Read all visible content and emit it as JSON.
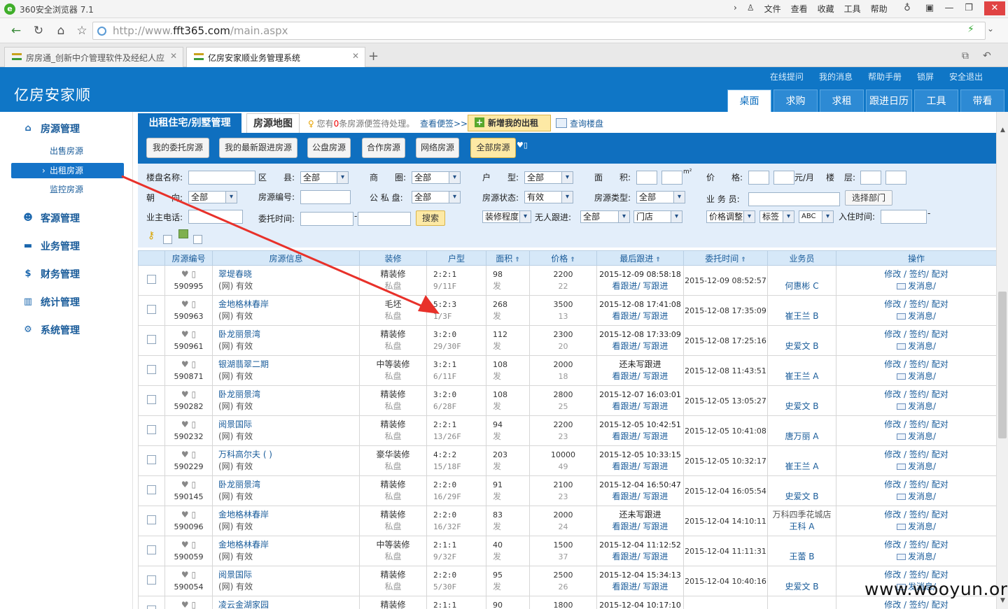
{
  "browser": {
    "title": "360安全浏览器 7.1",
    "menu": [
      "文件",
      "查看",
      "收藏",
      "工具",
      "帮助"
    ],
    "url_prefix": "http://www.",
    "url_host": "fft365.com",
    "url_path": "/main.aspx",
    "tabs": [
      {
        "label": "房房通_创新中介管理软件及经纪人应"
      },
      {
        "label": "亿房安家顺业务管理系统"
      }
    ]
  },
  "app": {
    "brand": "亿房安家顺",
    "top_links": [
      "在线提问",
      "我的消息",
      "帮助手册",
      "锁屏",
      "安全退出"
    ],
    "nav_tabs": [
      "桌面",
      "求购",
      "求租",
      "跟进日历",
      "工具",
      "带看"
    ]
  },
  "sidebar": {
    "groups": [
      {
        "label": "房源管理",
        "icon": "house-icon"
      },
      {
        "label": "客源管理",
        "icon": "users-icon"
      },
      {
        "label": "业务管理",
        "icon": "car-icon"
      },
      {
        "label": "财务管理",
        "icon": "money-icon"
      },
      {
        "label": "统计管理",
        "icon": "bar-chart-icon"
      },
      {
        "label": "系统管理",
        "icon": "gear-icon"
      }
    ],
    "subitems": [
      "出售房源",
      "出租房源",
      "监控房源"
    ]
  },
  "main": {
    "tab_active": "出租住宅/别墅管理",
    "tab_map": "房源地图",
    "notice_pre": "您有",
    "notice_count": "0",
    "notice_post": "条房源便签待处理。",
    "notice_link": "查看便签>>",
    "add_button": "新增我的出租",
    "query_link": "查询楼盘",
    "scope_buttons": [
      "我的委托房源",
      "我的最新跟进房源",
      "公盘房源",
      "合作房源",
      "网络房源",
      "全部房源"
    ]
  },
  "filters": {
    "estate_label": "楼盘名称:",
    "district_label": "区　　县:",
    "district_value": "全部",
    "circle_label": "商　　圈:",
    "circle_value": "全部",
    "layout_label": "户　　型:",
    "layout_value": "全部",
    "area_label": "面　　积:",
    "area_unit": "m²",
    "price_label": "价　　格:",
    "price_unit": "元/月",
    "building_label": "楼",
    "floor_label": "层:",
    "orient_label": "朝　　向:",
    "orient_value": "全部",
    "code_label": "房源编号:",
    "public_label": "公 私 盘:",
    "public_value": "全部",
    "status_label": "房源状态:",
    "status_value": "有效",
    "type_label": "房源类型:",
    "type_value": "全部",
    "agent_label": "业 务 员:",
    "dept_button": "选择部门",
    "owner_phone_label": "业主电话:",
    "entrust_label": "委托时间:",
    "search_button": "搜索",
    "decor_value": "装修程度",
    "nofollow_label": "无人跟进:",
    "nofollow_value": "全部",
    "store_value": "门店",
    "priceadj_value": "价格调整",
    "tag_value": "标签",
    "abc_value": "ABC",
    "checkin_label": "入住时间:"
  },
  "table": {
    "headers": [
      "房源编号",
      "房源信息",
      "装修",
      "户型",
      "面积",
      "价格",
      "最后跟进",
      "委托时间",
      "业务员",
      "操作"
    ],
    "ops_line1": [
      "修改",
      "签约",
      "配对"
    ],
    "ops_line2": "发消息",
    "rows": [
      {
        "id": "590995",
        "name": "翠堤春晓",
        "src": "(网) 有效",
        "decor": "精装修",
        "pub": "私盘",
        "layout": "2:2:1",
        "floor": "9/11F",
        "area": "98",
        "area2": "发",
        "price": "2200",
        "price2": "22",
        "last": "2015-12-09 08:58:18",
        "entrust": "2015-12-09 08:52:57",
        "agent_store": "",
        "agent": "何惠彬 C"
      },
      {
        "id": "590963",
        "name": "金地格林春岸",
        "src": "(网) 有效",
        "decor": "毛坯",
        "pub": "私盘",
        "layout": "5:2:3",
        "floor": "1/3F",
        "area": "268",
        "area2": "发",
        "price": "3500",
        "price2": "13",
        "last": "2015-12-08 17:41:08",
        "entrust": "2015-12-08 17:35:09",
        "agent_store": "",
        "agent": "崔王兰 B"
      },
      {
        "id": "590961",
        "name": "卧龙丽景湾",
        "src": "(网) 有效",
        "decor": "精装修",
        "pub": "私盘",
        "layout": "3:2:0",
        "floor": "29/30F",
        "area": "112",
        "area2": "发",
        "price": "2300",
        "price2": "20",
        "last": "2015-12-08 17:33:09",
        "entrust": "2015-12-08 17:25:16",
        "agent_store": "",
        "agent": "史爱文 B"
      },
      {
        "id": "590871",
        "name": "银湖翡翠二期",
        "src": "(网) 有效",
        "decor": "中等装修",
        "pub": "私盘",
        "layout": "3:2:1",
        "floor": "6/11F",
        "area": "108",
        "area2": "发",
        "price": "2000",
        "price2": "18",
        "last": "还未写跟进",
        "entrust": "2015-12-08 11:43:51",
        "agent_store": "",
        "agent": "崔王兰 A"
      },
      {
        "id": "590282",
        "name": "卧龙丽景湾",
        "src": "(网) 有效",
        "decor": "精装修",
        "pub": "私盘",
        "layout": "3:2:0",
        "floor": "6/28F",
        "area": "108",
        "area2": "发",
        "price": "2800",
        "price2": "25",
        "last": "2015-12-07 16:03:01",
        "entrust": "2015-12-05 13:05:27",
        "agent_store": "",
        "agent": "史爱文 B"
      },
      {
        "id": "590232",
        "name": "阅景国际",
        "src": "(网) 有效",
        "decor": "精装修",
        "pub": "私盘",
        "layout": "2:2:1",
        "floor": "13/26F",
        "area": "94",
        "area2": "发",
        "price": "2200",
        "price2": "23",
        "last": "2015-12-05 10:42:51",
        "entrust": "2015-12-05 10:41:08",
        "agent_store": "",
        "agent": "唐万丽 A"
      },
      {
        "id": "590229",
        "name": "万科高尔夫 ( )",
        "src": "(网) 有效",
        "decor": "豪华装修",
        "pub": "私盘",
        "layout": "4:2:2",
        "floor": "15/18F",
        "area": "203",
        "area2": "发",
        "price": "10000",
        "price2": "49",
        "last": "2015-12-05 10:33:15",
        "entrust": "2015-12-05 10:32:17",
        "agent_store": "",
        "agent": "崔王兰 A"
      },
      {
        "id": "590145",
        "name": "卧龙丽景湾",
        "src": "(网) 有效",
        "decor": "精装修",
        "pub": "私盘",
        "layout": "2:2:0",
        "floor": "16/29F",
        "area": "91",
        "area2": "发",
        "price": "2100",
        "price2": "23",
        "last": "2015-12-04 16:50:47",
        "entrust": "2015-12-04 16:05:54",
        "agent_store": "",
        "agent": "史爱文 B"
      },
      {
        "id": "590096",
        "name": "金地格林春岸",
        "src": "(网) 有效",
        "decor": "精装修",
        "pub": "私盘",
        "layout": "2:2:0",
        "floor": "16/32F",
        "area": "83",
        "area2": "发",
        "price": "2000",
        "price2": "24",
        "last": "还未写跟进",
        "entrust": "2015-12-04 14:10:11",
        "agent_store": "万科四季花城店",
        "agent": "王科 A"
      },
      {
        "id": "590059",
        "name": "金地格林春岸",
        "src": "(网) 有效",
        "decor": "中等装修",
        "pub": "私盘",
        "layout": "2:1:1",
        "floor": "9/32F",
        "area": "40",
        "area2": "发",
        "price": "1500",
        "price2": "37",
        "last": "2015-12-04 11:12:52",
        "entrust": "2015-12-04 11:11:31",
        "agent_store": "",
        "agent": "王蕾 B"
      },
      {
        "id": "590054",
        "name": "阅景国际",
        "src": "(网) 有效",
        "decor": "精装修",
        "pub": "私盘",
        "layout": "2:2:0",
        "floor": "5/30F",
        "area": "95",
        "area2": "发",
        "price": "2500",
        "price2": "26",
        "last": "2015-12-04 15:34:13",
        "entrust": "2015-12-04 10:40:16",
        "agent_store": "",
        "agent": "史爱文 B"
      },
      {
        "id": "",
        "name": "凌云金湖家园",
        "src": "",
        "decor": "精装修",
        "pub": "",
        "layout": "2:1:1",
        "floor": "",
        "area": "90",
        "area2": "",
        "price": "1800",
        "price2": "",
        "last": "2015-12-04 10:17:10",
        "entrust": "",
        "agent_store": "",
        "agent": ""
      }
    ],
    "followup_links": [
      "看跟进",
      "写跟进"
    ]
  },
  "watermark": "www.wooyun.org",
  "colors": {
    "primary": "#0f76c6",
    "accent_yellow": "#fde9a5",
    "arrow": "#e8312a"
  }
}
